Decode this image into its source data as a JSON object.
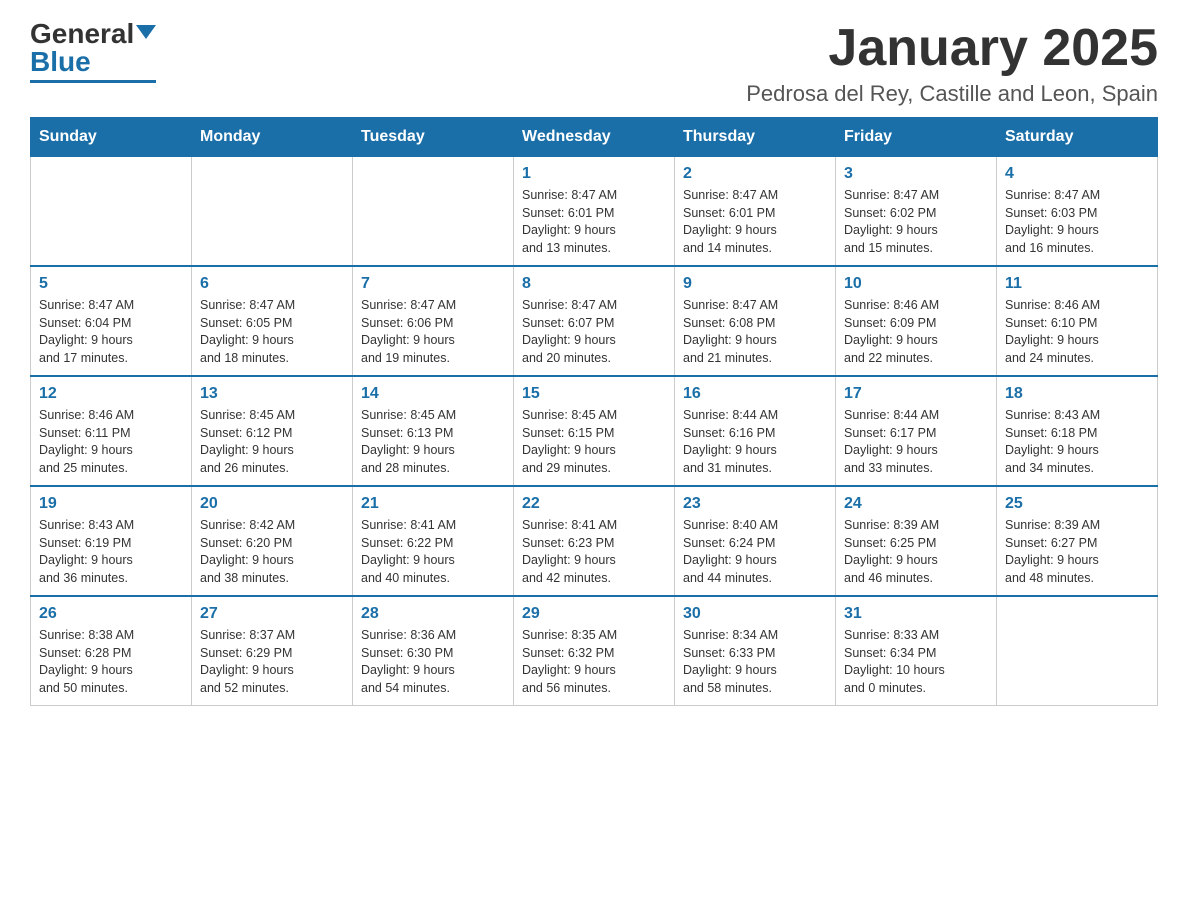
{
  "logo": {
    "general": "General",
    "blue": "Blue"
  },
  "title": "January 2025",
  "subtitle": "Pedrosa del Rey, Castille and Leon, Spain",
  "days_of_week": [
    "Sunday",
    "Monday",
    "Tuesday",
    "Wednesday",
    "Thursday",
    "Friday",
    "Saturday"
  ],
  "weeks": [
    [
      {
        "day": "",
        "info": ""
      },
      {
        "day": "",
        "info": ""
      },
      {
        "day": "",
        "info": ""
      },
      {
        "day": "1",
        "info": "Sunrise: 8:47 AM\nSunset: 6:01 PM\nDaylight: 9 hours\nand 13 minutes."
      },
      {
        "day": "2",
        "info": "Sunrise: 8:47 AM\nSunset: 6:01 PM\nDaylight: 9 hours\nand 14 minutes."
      },
      {
        "day": "3",
        "info": "Sunrise: 8:47 AM\nSunset: 6:02 PM\nDaylight: 9 hours\nand 15 minutes."
      },
      {
        "day": "4",
        "info": "Sunrise: 8:47 AM\nSunset: 6:03 PM\nDaylight: 9 hours\nand 16 minutes."
      }
    ],
    [
      {
        "day": "5",
        "info": "Sunrise: 8:47 AM\nSunset: 6:04 PM\nDaylight: 9 hours\nand 17 minutes."
      },
      {
        "day": "6",
        "info": "Sunrise: 8:47 AM\nSunset: 6:05 PM\nDaylight: 9 hours\nand 18 minutes."
      },
      {
        "day": "7",
        "info": "Sunrise: 8:47 AM\nSunset: 6:06 PM\nDaylight: 9 hours\nand 19 minutes."
      },
      {
        "day": "8",
        "info": "Sunrise: 8:47 AM\nSunset: 6:07 PM\nDaylight: 9 hours\nand 20 minutes."
      },
      {
        "day": "9",
        "info": "Sunrise: 8:47 AM\nSunset: 6:08 PM\nDaylight: 9 hours\nand 21 minutes."
      },
      {
        "day": "10",
        "info": "Sunrise: 8:46 AM\nSunset: 6:09 PM\nDaylight: 9 hours\nand 22 minutes."
      },
      {
        "day": "11",
        "info": "Sunrise: 8:46 AM\nSunset: 6:10 PM\nDaylight: 9 hours\nand 24 minutes."
      }
    ],
    [
      {
        "day": "12",
        "info": "Sunrise: 8:46 AM\nSunset: 6:11 PM\nDaylight: 9 hours\nand 25 minutes."
      },
      {
        "day": "13",
        "info": "Sunrise: 8:45 AM\nSunset: 6:12 PM\nDaylight: 9 hours\nand 26 minutes."
      },
      {
        "day": "14",
        "info": "Sunrise: 8:45 AM\nSunset: 6:13 PM\nDaylight: 9 hours\nand 28 minutes."
      },
      {
        "day": "15",
        "info": "Sunrise: 8:45 AM\nSunset: 6:15 PM\nDaylight: 9 hours\nand 29 minutes."
      },
      {
        "day": "16",
        "info": "Sunrise: 8:44 AM\nSunset: 6:16 PM\nDaylight: 9 hours\nand 31 minutes."
      },
      {
        "day": "17",
        "info": "Sunrise: 8:44 AM\nSunset: 6:17 PM\nDaylight: 9 hours\nand 33 minutes."
      },
      {
        "day": "18",
        "info": "Sunrise: 8:43 AM\nSunset: 6:18 PM\nDaylight: 9 hours\nand 34 minutes."
      }
    ],
    [
      {
        "day": "19",
        "info": "Sunrise: 8:43 AM\nSunset: 6:19 PM\nDaylight: 9 hours\nand 36 minutes."
      },
      {
        "day": "20",
        "info": "Sunrise: 8:42 AM\nSunset: 6:20 PM\nDaylight: 9 hours\nand 38 minutes."
      },
      {
        "day": "21",
        "info": "Sunrise: 8:41 AM\nSunset: 6:22 PM\nDaylight: 9 hours\nand 40 minutes."
      },
      {
        "day": "22",
        "info": "Sunrise: 8:41 AM\nSunset: 6:23 PM\nDaylight: 9 hours\nand 42 minutes."
      },
      {
        "day": "23",
        "info": "Sunrise: 8:40 AM\nSunset: 6:24 PM\nDaylight: 9 hours\nand 44 minutes."
      },
      {
        "day": "24",
        "info": "Sunrise: 8:39 AM\nSunset: 6:25 PM\nDaylight: 9 hours\nand 46 minutes."
      },
      {
        "day": "25",
        "info": "Sunrise: 8:39 AM\nSunset: 6:27 PM\nDaylight: 9 hours\nand 48 minutes."
      }
    ],
    [
      {
        "day": "26",
        "info": "Sunrise: 8:38 AM\nSunset: 6:28 PM\nDaylight: 9 hours\nand 50 minutes."
      },
      {
        "day": "27",
        "info": "Sunrise: 8:37 AM\nSunset: 6:29 PM\nDaylight: 9 hours\nand 52 minutes."
      },
      {
        "day": "28",
        "info": "Sunrise: 8:36 AM\nSunset: 6:30 PM\nDaylight: 9 hours\nand 54 minutes."
      },
      {
        "day": "29",
        "info": "Sunrise: 8:35 AM\nSunset: 6:32 PM\nDaylight: 9 hours\nand 56 minutes."
      },
      {
        "day": "30",
        "info": "Sunrise: 8:34 AM\nSunset: 6:33 PM\nDaylight: 9 hours\nand 58 minutes."
      },
      {
        "day": "31",
        "info": "Sunrise: 8:33 AM\nSunset: 6:34 PM\nDaylight: 10 hours\nand 0 minutes."
      },
      {
        "day": "",
        "info": ""
      }
    ]
  ]
}
